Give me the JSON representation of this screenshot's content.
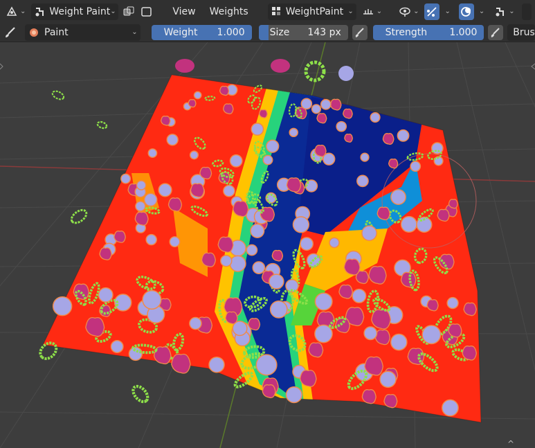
{
  "header": {
    "mode_label": "Weight Paint",
    "menus": [
      "View",
      "Weights"
    ],
    "workspace_label": "WeightPaint"
  },
  "tool_settings": {
    "brush_name": "Paint",
    "weight": {
      "label": "Weight",
      "value": "1.000"
    },
    "size": {
      "label": "Size",
      "value": "143 px"
    },
    "strength": {
      "label": "Strength",
      "value": "1.000"
    },
    "brush_menu_label": "Brus"
  },
  "colors": {
    "accent": "#4772b3",
    "header_bg": "#303030",
    "viewport_bg": "#3d3d3d"
  },
  "icons": [
    "gizmo-icon",
    "weight-paint-mode-icon",
    "chevron-down-icon",
    "xray-toggle-icon",
    "brush-icon",
    "pressure-icon",
    "visibility-icon",
    "snap-icon",
    "overlay-icon",
    "shading-icon"
  ]
}
